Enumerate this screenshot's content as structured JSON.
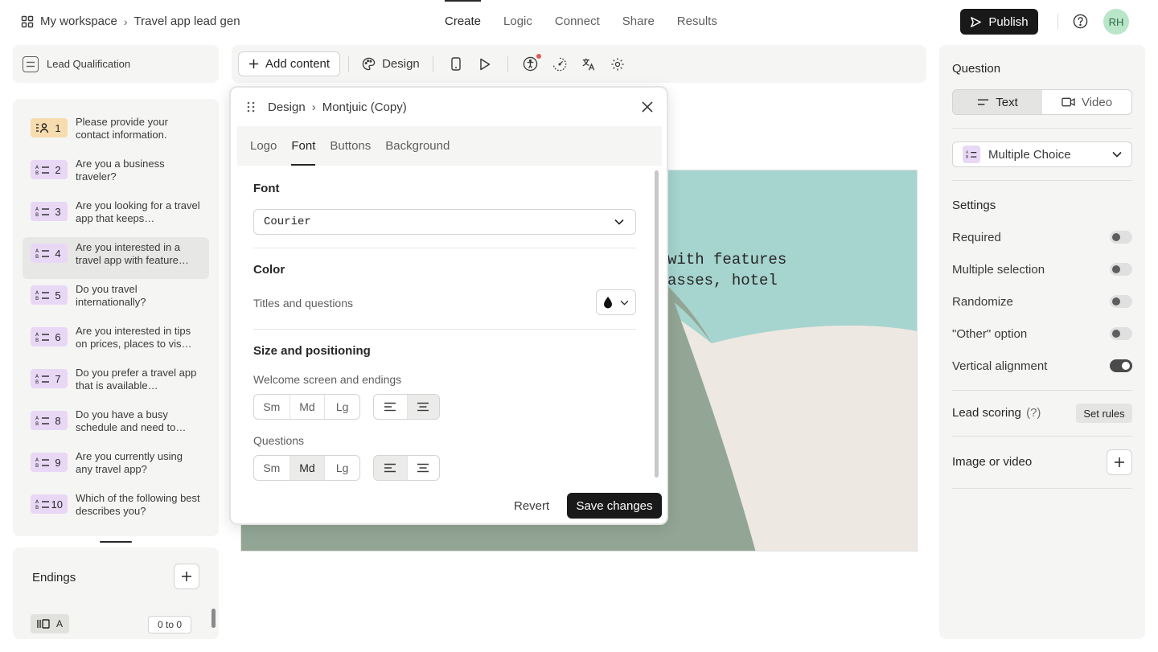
{
  "header": {
    "workspace": "My workspace",
    "project": "Travel app lead gen",
    "tabs": [
      "Create",
      "Logic",
      "Connect",
      "Share",
      "Results"
    ],
    "active_tab": "Create",
    "publish_label": "Publish",
    "avatar_initials": "RH"
  },
  "sidebar": {
    "form_title": "Lead Qualification",
    "questions": [
      {
        "num": "1",
        "text": "Please provide your contact information.",
        "type": "contact"
      },
      {
        "num": "2",
        "text": "Are you a business traveler?",
        "type": "multiple-choice"
      },
      {
        "num": "3",
        "text": "Are you looking for a travel app that keeps…",
        "type": "multiple-choice"
      },
      {
        "num": "4",
        "text": "Are you interested in a travel app with feature…",
        "type": "multiple-choice"
      },
      {
        "num": "5",
        "text": "Do you travel internationally?",
        "type": "multiple-choice"
      },
      {
        "num": "6",
        "text": "Are you interested in tips on prices, places to vis…",
        "type": "multiple-choice"
      },
      {
        "num": "7",
        "text": "Do you prefer a travel app that is available…",
        "type": "multiple-choice"
      },
      {
        "num": "8",
        "text": "Do you have a busy schedule and need to…",
        "type": "multiple-choice"
      },
      {
        "num": "9",
        "text": "Are you currently using any travel app?",
        "type": "multiple-choice"
      },
      {
        "num": "10",
        "text": "Which of the following best describes you?",
        "type": "multiple-choice"
      }
    ],
    "selected_question": "4",
    "endings": {
      "title": "Endings",
      "item_label": "A",
      "item_range": "0 to 0"
    }
  },
  "toolbar": {
    "add_content_label": "Add content",
    "design_label": "Design"
  },
  "preview": {
    "question_text": "with features\nasses, hotel",
    "colors": {
      "teal": "#a6d4ce",
      "sage": "#93a695",
      "cream": "#ede8e1"
    }
  },
  "design_modal": {
    "breadcrumb_root": "Design",
    "theme_name": "Montjuic (Copy)",
    "tabs": [
      "Logo",
      "Font",
      "Buttons",
      "Background"
    ],
    "active_tab": "Font",
    "font_section_title": "Font",
    "font_value": "Courier",
    "color_section_title": "Color",
    "color_label": "Titles and questions",
    "color_value": "#111111",
    "size_section_title": "Size and positioning",
    "welcome_label": "Welcome screen and endings",
    "welcome_size_options": [
      "Sm",
      "Md",
      "Lg"
    ],
    "welcome_size_selected": "",
    "welcome_alignment_selected": "center",
    "questions_label": "Questions",
    "questions_size_options": [
      "Sm",
      "Md",
      "Lg"
    ],
    "questions_size_selected": "Md",
    "questions_alignment_selected": "left",
    "revert_label": "Revert",
    "save_label": "Save changes"
  },
  "right_panel": {
    "question_title": "Question",
    "text_label": "Text",
    "video_label": "Video",
    "question_type": "Multiple Choice",
    "settings_title": "Settings",
    "settings": [
      {
        "label": "Required",
        "on": false
      },
      {
        "label": "Multiple selection",
        "on": false
      },
      {
        "label": "Randomize",
        "on": false
      },
      {
        "label": "\"Other\" option",
        "on": false
      },
      {
        "label": "Vertical alignment",
        "on": true
      }
    ],
    "lead_scoring_label": "Lead scoring",
    "lead_scoring_hint": "(?)",
    "set_rules_label": "Set rules",
    "image_video_label": "Image or video"
  }
}
